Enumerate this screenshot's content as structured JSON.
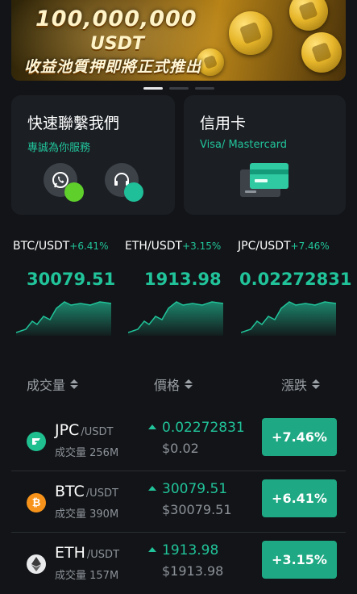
{
  "banner": {
    "title": "100,000,000",
    "subtitle": "USDT",
    "caption": "收益池質押即將正式推出",
    "slides": 3,
    "active_slide": 0
  },
  "cards": {
    "contact": {
      "title": "快速聯繫我們",
      "subtitle": "專誠為你服務",
      "icons": [
        "whatsapp-icon",
        "headset-icon"
      ]
    },
    "credit": {
      "title": "信用卡",
      "subtitle": "Visa/ Mastercard",
      "icon": "credit-card-icon"
    }
  },
  "tickers": [
    {
      "pair": "BTC/USDT",
      "change": "+6.41%",
      "price": "30079.51"
    },
    {
      "pair": "ETH/USDT",
      "change": "+3.15%",
      "price": "1913.98"
    },
    {
      "pair": "JPC/USDT",
      "change": "+7.46%",
      "price": "0.02272831"
    }
  ],
  "table": {
    "headers": {
      "volume": "成交量",
      "price": "價格",
      "change": "漲跌"
    },
    "rows": [
      {
        "symbol": "JPC",
        "quote": "/USDT",
        "volume": "成交量 256M",
        "price": "0.02272831",
        "fiat": "$0.02",
        "change": "+7.46%",
        "icon": "jpc-coin-icon"
      },
      {
        "symbol": "BTC",
        "quote": "/USDT",
        "volume": "成交量 390M",
        "price": "30079.51",
        "fiat": "$30079.51",
        "change": "+6.41%",
        "icon": "bitcoin-icon"
      },
      {
        "symbol": "ETH",
        "quote": "/USDT",
        "volume": "成交量 157M",
        "price": "1913.98",
        "fiat": "$1913.98",
        "change": "+3.15%",
        "icon": "ethereum-icon"
      }
    ]
  },
  "colors": {
    "accent": "#21c39a",
    "button": "#1ea883",
    "background": "#121417",
    "card": "#1b1f24"
  }
}
